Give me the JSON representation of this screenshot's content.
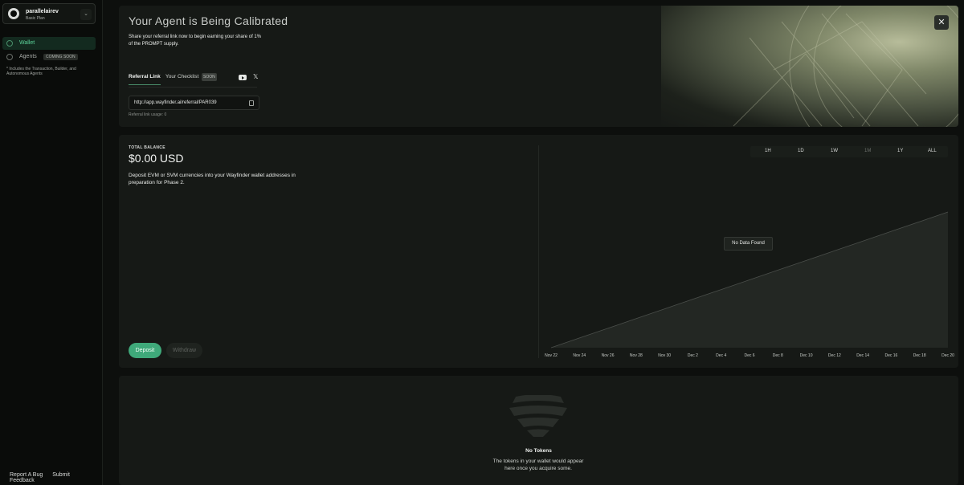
{
  "sidebar": {
    "account": {
      "name": "parallelairev",
      "plan": "Basic Plan"
    },
    "items": [
      {
        "label": "Wallet",
        "icon": "wallet-icon",
        "active": true
      },
      {
        "label": "Agents",
        "icon": "agents-icon",
        "badge": "COMING SOON"
      }
    ],
    "note": "* Includes the Transaction, Builder, and Autonomous Agents",
    "footer": {
      "report_bug": "Report A Bug",
      "feedback": "Submit Feedback"
    }
  },
  "referral": {
    "title": "Your Agent is Being Calibrated",
    "subtitle": "Share your referral link now to begin earning your share of 1% of the PROMPT supply.",
    "tabs": {
      "referral_link": "Referral Link",
      "checklist": "Your Checklist",
      "soon": "SOON"
    },
    "link": "http://app.wayfinder.ai/referral/PAR039",
    "usage": "Referral link usage: 0"
  },
  "balance": {
    "label": "TOTAL BALANCE",
    "value": "$0.00 USD",
    "description": "Deposit EVM or SVM currencies into your Wayfinder wallet addresses in preparation for Phase 2.",
    "deposit": "Deposit",
    "withdraw": "Withdraw",
    "ranges": [
      "1H",
      "1D",
      "1W",
      "1M",
      "1Y",
      "ALL"
    ],
    "no_data": "No Data Found"
  },
  "chart_data": {
    "type": "area",
    "x": [
      "Nov 22",
      "Nov 24",
      "Nov 26",
      "Nov 28",
      "Nov 30",
      "Dec 2",
      "Dec 4",
      "Dec 6",
      "Dec 8",
      "Dec 10",
      "Dec 12",
      "Dec 14",
      "Dec 16",
      "Dec 18",
      "Dec 20"
    ],
    "series": [
      {
        "values": [
          0,
          1,
          2,
          3,
          4,
          5,
          6,
          7,
          8,
          9,
          10,
          11,
          12,
          13,
          14
        ]
      }
    ],
    "grid": false
  },
  "tokens": {
    "title": "No Tokens",
    "description": "The tokens in your wallet would appear here once you acquire some."
  },
  "colors": {
    "accent": "#3fa97a",
    "panel": "#161916",
    "background": "#0d0f0d"
  }
}
